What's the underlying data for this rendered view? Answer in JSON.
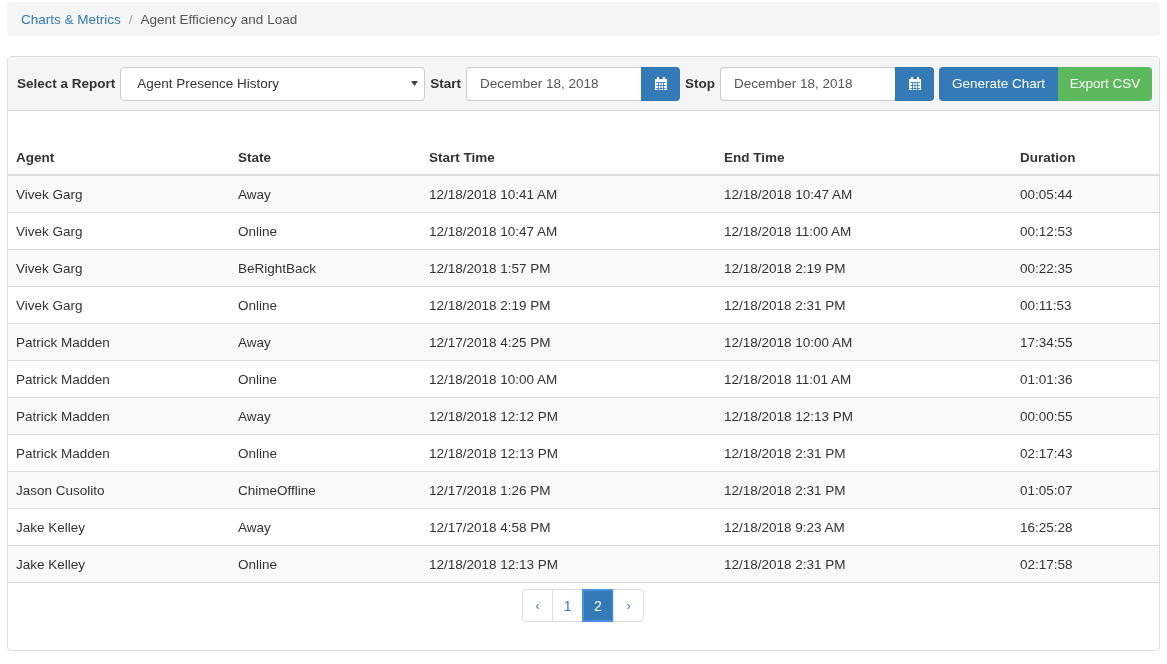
{
  "breadcrumb_separator": "/",
  "breadcrumb": [
    {
      "label": "Charts & Metrics",
      "link": true
    },
    {
      "label": "Agent Efficiency and Load",
      "link": false
    }
  ],
  "toolbar": {
    "report_label": "Select a Report",
    "report_value": "Agent Presence History",
    "start_label": "Start",
    "start_value": "December 18, 2018",
    "stop_label": "Stop",
    "stop_value": "December 18, 2018",
    "buttons": [
      {
        "label": "Generate Chart",
        "kind": "primary"
      },
      {
        "label": "Export CSV",
        "kind": "success"
      }
    ]
  },
  "table": {
    "columns": [
      "Agent",
      "State",
      "Start Time",
      "End Time",
      "Duration"
    ],
    "rows": [
      [
        "Vivek Garg",
        "Away",
        "12/18/2018 10:41 AM",
        "12/18/2018 10:47 AM",
        "00:05:44"
      ],
      [
        "Vivek Garg",
        "Online",
        "12/18/2018 10:47 AM",
        "12/18/2018 11:00 AM",
        "00:12:53"
      ],
      [
        "Vivek Garg",
        "BeRightBack",
        "12/18/2018 1:57 PM",
        "12/18/2018 2:19 PM",
        "00:22:35"
      ],
      [
        "Vivek Garg",
        "Online",
        "12/18/2018 2:19 PM",
        "12/18/2018 2:31 PM",
        "00:11:53"
      ],
      [
        "Patrick Madden",
        "Away",
        "12/17/2018 4:25 PM",
        "12/18/2018 10:00 AM",
        "17:34:55"
      ],
      [
        "Patrick Madden",
        "Online",
        "12/18/2018 10:00 AM",
        "12/18/2018 11:01 AM",
        "01:01:36"
      ],
      [
        "Patrick Madden",
        "Away",
        "12/18/2018 12:12 PM",
        "12/18/2018 12:13 PM",
        "00:00:55"
      ],
      [
        "Patrick Madden",
        "Online",
        "12/18/2018 12:13 PM",
        "12/18/2018 2:31 PM",
        "02:17:43"
      ],
      [
        "Jason Cusolito",
        "ChimeOffline",
        "12/17/2018 1:26 PM",
        "12/18/2018 2:31 PM",
        "01:05:07"
      ],
      [
        "Jake Kelley",
        "Away",
        "12/17/2018 4:58 PM",
        "12/18/2018 9:23 AM",
        "16:25:28"
      ],
      [
        "Jake Kelley",
        "Online",
        "12/18/2018 12:13 PM",
        "12/18/2018 2:31 PM",
        "02:17:58"
      ]
    ]
  },
  "pagination": {
    "prev": "‹",
    "next": "›",
    "pages": [
      {
        "label": "1",
        "selected": false
      },
      {
        "label": "2",
        "selected": true
      }
    ]
  }
}
